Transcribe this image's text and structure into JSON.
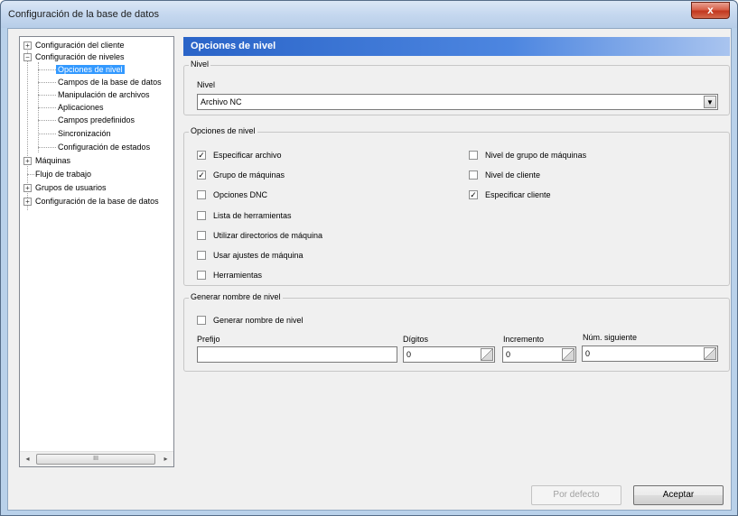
{
  "window": {
    "title": "Configuración de la base de datos",
    "close_label": "x"
  },
  "tree": {
    "items": [
      {
        "label": "Configuración del cliente",
        "expander": "+"
      },
      {
        "label": "Configuración de niveles",
        "expander": "−"
      },
      {
        "label": "Opciones de nivel",
        "selected": true
      },
      {
        "label": "Campos de la base de datos"
      },
      {
        "label": "Manipulación de archivos"
      },
      {
        "label": "Aplicaciones"
      },
      {
        "label": "Campos predefinidos"
      },
      {
        "label": "Sincronización"
      },
      {
        "label": "Configuración de estados"
      },
      {
        "label": "Máquinas",
        "expander": "+"
      },
      {
        "label": "Flujo de trabajo"
      },
      {
        "label": "Grupos de usuarios",
        "expander": "+"
      },
      {
        "label": "Configuración de la base de datos",
        "expander": "+"
      }
    ],
    "scroll_left": "◂",
    "scroll_right": "▸",
    "scroll_grip": "III"
  },
  "panel": {
    "header": "Opciones de nivel",
    "nivel_group": {
      "legend": "Nivel",
      "field_label": "Nivel",
      "selected_value": "Archivo NC",
      "dropdown_glyph": "▼"
    },
    "options_group": {
      "legend": "Opciones de nivel",
      "left": [
        {
          "label": "Especificar archivo",
          "checked": true
        },
        {
          "label": "Grupo de máquinas",
          "checked": true
        },
        {
          "label": "Opciones DNC",
          "checked": false
        },
        {
          "label": "Lista de herramientas",
          "checked": false
        },
        {
          "label": "Utilizar directorios de máquina",
          "checked": false
        },
        {
          "label": "Usar ajustes de máquina",
          "checked": false
        },
        {
          "label": "Herramientas",
          "checked": false
        }
      ],
      "right": [
        {
          "label": "Nivel de grupo de máquinas",
          "checked": false
        },
        {
          "label": "Nivel de cliente",
          "checked": false
        },
        {
          "label": "Especificar cliente",
          "checked": true
        }
      ],
      "check_glyph": "✓"
    },
    "name_group": {
      "legend": "Generar nombre de nivel",
      "checkbox_label": "Generar nombre de nivel",
      "checkbox_checked": false,
      "prefix_label": "Prefijo",
      "prefix_value": "",
      "digits_label": "Dígitos",
      "digits_value": "0",
      "increment_label": "Incremento",
      "increment_value": "0",
      "next_label": "Núm. siguiente",
      "next_value": "0"
    }
  },
  "buttons": {
    "default_label": "Por defecto",
    "accept_label": "Aceptar"
  }
}
